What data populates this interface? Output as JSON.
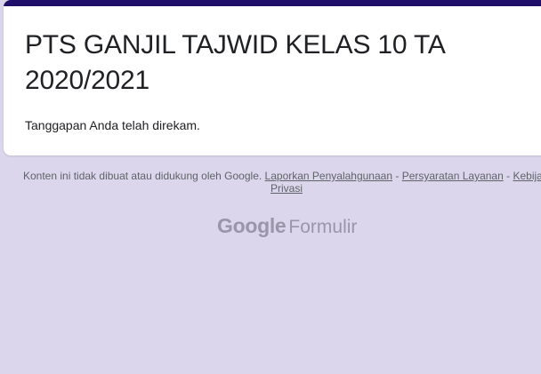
{
  "form": {
    "title": "PTS GANJIL TAJWID KELAS 10 TA 2020/2021",
    "response_message": "Tanggapan Anda telah direkam."
  },
  "footer": {
    "disclaimer_text": "Konten ini tidak dibuat atau didukung oleh Google.",
    "links": {
      "report_abuse": "Laporkan Penyalahgunaan",
      "terms": "Persyaratan Layanan",
      "privacy_prefix": "Kebijakan",
      "privacy_suffix": "Privasi"
    },
    "separator": "-"
  },
  "logo": {
    "google": "Google",
    "product": "Formulir"
  },
  "colors": {
    "page_background": "#dcd6ec",
    "accent_bar": "#1f0f6b",
    "card_background": "#ffffff",
    "text_primary": "#202124",
    "text_secondary": "#5f6368"
  }
}
